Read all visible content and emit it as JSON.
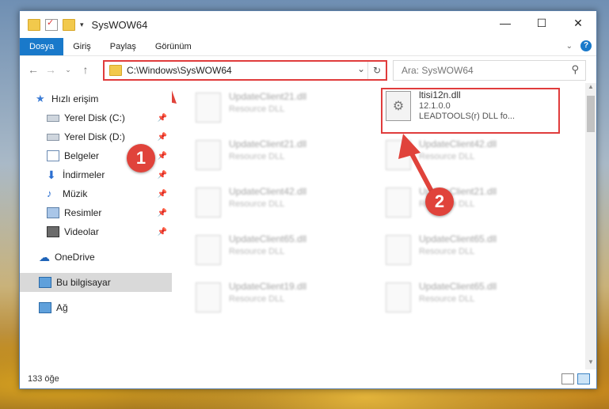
{
  "window": {
    "title": "SysWOW64",
    "minimize_icon": "minimize-icon",
    "maximize_icon": "maximize-icon",
    "close_icon": "close-icon"
  },
  "ribbon": {
    "tabs": [
      "Dosya",
      "Giriş",
      "Paylaş",
      "Görünüm"
    ]
  },
  "nav": {
    "address": "C:\\Windows\\SysWOW64",
    "search_placeholder": "Ara: SysWOW64"
  },
  "sidebar": {
    "items": [
      {
        "label": "Hızlı erişim",
        "icon": "star-icon"
      },
      {
        "label": "Yerel Disk (C:)",
        "icon": "disk-icon",
        "pinned": true
      },
      {
        "label": "Yerel Disk (D:)",
        "icon": "disk-icon",
        "pinned": true
      },
      {
        "label": "Belgeler",
        "icon": "documents-icon",
        "pinned": true
      },
      {
        "label": "İndirmeler",
        "icon": "download-icon",
        "pinned": true
      },
      {
        "label": "Müzik",
        "icon": "music-icon",
        "pinned": true
      },
      {
        "label": "Resimler",
        "icon": "pictures-icon",
        "pinned": true
      },
      {
        "label": "Videolar",
        "icon": "videos-icon",
        "pinned": true
      },
      {
        "label": "OneDrive",
        "icon": "cloud-icon"
      },
      {
        "label": "Bu bilgisayar",
        "icon": "computer-icon",
        "selected": true
      },
      {
        "label": "Ağ",
        "icon": "network-icon"
      }
    ]
  },
  "files": [
    {
      "name": "UpdateClient21.dll",
      "type": "Resource DLL"
    },
    {
      "name": "ltisi12n.dll",
      "version": "12.1.0.0",
      "description": "LEADTOOLS(r) DLL fo...",
      "highlighted": true
    },
    {
      "name": "UpdateClient21.dll",
      "type": "Resource DLL"
    },
    {
      "name": "UpdateClient42.dll",
      "type": "Resource DLL"
    },
    {
      "name": "UpdateClient42.dll",
      "type": "Resource DLL"
    },
    {
      "name": "UpdateClient21.dll",
      "type": "Resource DLL"
    },
    {
      "name": "UpdateClient65.dll",
      "type": "Resource DLL"
    },
    {
      "name": "UpdateClient65.dll",
      "type": "Resource DLL"
    },
    {
      "name": "UpdateClient19.dll",
      "type": "Resource DLL"
    },
    {
      "name": "UpdateClient65.dll",
      "type": "Resource DLL"
    }
  ],
  "status": {
    "item_count": "133 öğe"
  },
  "annotations": {
    "step1": "1",
    "step2": "2"
  },
  "colors": {
    "highlight": "#e03c3c",
    "accent": "#1979ca"
  }
}
